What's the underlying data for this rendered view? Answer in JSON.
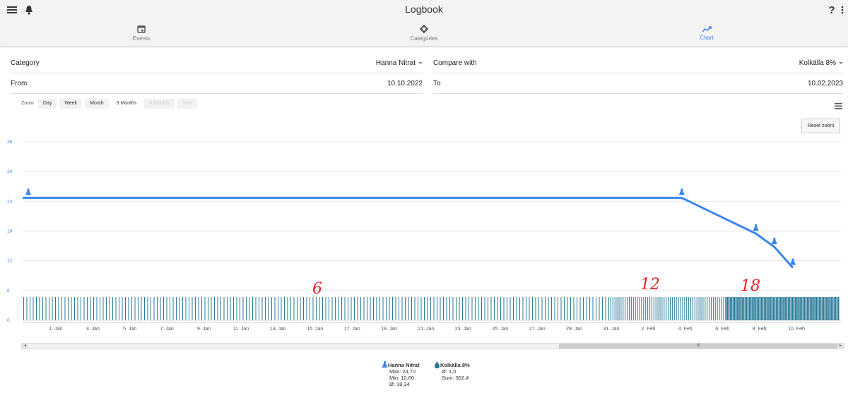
{
  "app": {
    "title": "Logbook"
  },
  "header": {
    "menu_icon": "hamburger-icon",
    "bell_icon": "bell-icon",
    "help_label": "?",
    "more_icon": "more-vert-icon"
  },
  "tabs": [
    {
      "label": "Events",
      "icon": "calendar-icon",
      "active": false
    },
    {
      "label": "Categories",
      "icon": "gear-icon",
      "active": false
    },
    {
      "label": "Chart",
      "icon": "trending-up-icon",
      "active": true
    }
  ],
  "filters": {
    "category_label": "Category",
    "category_value": "Hanna Nitrat",
    "compare_label": "Compare with",
    "compare_value": "Kolkälla 8%",
    "from_label": "From",
    "from_value": "10.10.2022",
    "to_label": "To",
    "to_value": "10.02.2023"
  },
  "zoom": {
    "label": "Zoom",
    "buttons": [
      {
        "label": "Day",
        "state": "normal"
      },
      {
        "label": "Week",
        "state": "normal"
      },
      {
        "label": "Month",
        "state": "normal"
      },
      {
        "label": "3 Months",
        "state": "active"
      },
      {
        "label": "6 Months",
        "state": "disabled"
      },
      {
        "label": "Year",
        "state": "disabled"
      }
    ]
  },
  "reset_zoom_label": "Reset zoom",
  "scrollbar": {
    "grip_label": "III"
  },
  "annotations": [
    "6",
    "12",
    "18"
  ],
  "colors": {
    "accent": "#4a86e8",
    "line": "#3a86f0",
    "bar": "#2a7a99",
    "handwriting": "#e8201e"
  },
  "chart_data": {
    "type": "line",
    "y_ticks": [
      "36",
      "30",
      "24",
      "18",
      "12",
      "6",
      "0"
    ],
    "ylim": [
      0,
      36
    ],
    "x_ticks": [
      "1. Jan",
      "3. Jan",
      "5. Jan",
      "7. Jan",
      "9. Jan",
      "11. Jan",
      "13. Jan",
      "15. Jan",
      "17. Jan",
      "19. Jan",
      "21. Jan",
      "23. Jan",
      "25. Jan",
      "27. Jan",
      "29. Jan",
      "31. Jan",
      "2. Feb",
      "4. Feb",
      "6. Feb",
      "8. Feb",
      "10. Feb"
    ],
    "grid": true,
    "series": [
      {
        "name": "Hanna Nitrat",
        "kind": "line",
        "points": [
          [
            "2022-12-31",
            24.7
          ],
          [
            "2023-02-04",
            24.7
          ],
          [
            "2023-02-08",
            17.5
          ],
          [
            "2023-02-09",
            14.8
          ],
          [
            "2023-02-10",
            10.6
          ]
        ],
        "markers": [
          "2022-12-31",
          "2023-02-04",
          "2023-02-08",
          "2023-02-09",
          "2023-02-10"
        ]
      },
      {
        "name": "Kolkälla 8%",
        "kind": "column",
        "value": 1.0
      }
    ],
    "legend": [
      {
        "name": "Hanna Nitrat",
        "icon": "flask-icon",
        "lines": [
          "Max: 24,70",
          "Min: 10,60",
          "Ø: 18,34"
        ]
      },
      {
        "name": "Kolkälla 8%",
        "icon": "drop-icon",
        "lines": [
          "Ø: 1,0",
          "Sum: 362,4"
        ]
      }
    ],
    "legend_position": "bottom"
  }
}
